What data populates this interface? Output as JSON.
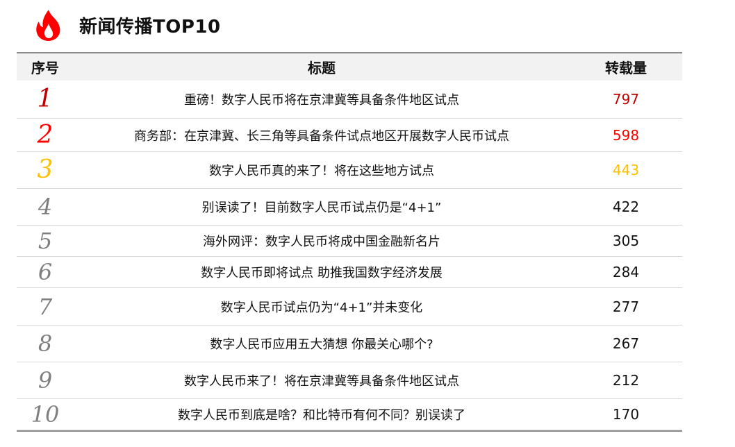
{
  "header": {
    "title": "新闻传播TOP10",
    "icon": "flame-icon",
    "icon_color": "#ff0000"
  },
  "table": {
    "columns": [
      "序号",
      "标题",
      "转载量"
    ],
    "rows": [
      {
        "rank": "1",
        "title": "重磅！数字人民币将在京津冀等具备条件地区试点",
        "count": "797"
      },
      {
        "rank": "2",
        "title": "商务部：在京津冀、长三角等具备条件试点地区开展数字人民币试点",
        "count": "598"
      },
      {
        "rank": "3",
        "title": "数字人民币真的来了！将在这些地方试点",
        "count": "443"
      },
      {
        "rank": "4",
        "title": "别误读了！目前数字人民币试点仍是“4+1”",
        "count": "422"
      },
      {
        "rank": "5",
        "title": "海外网评：数字人民币将成中国金融新名片",
        "count": "305"
      },
      {
        "rank": "6",
        "title": "数字人民币即将试点 助推我国数字经济发展",
        "count": "284"
      },
      {
        "rank": "7",
        "title": "数字人民币试点仍为“4+1”并未变化",
        "count": "277"
      },
      {
        "rank": "8",
        "title": "数字人民币应用五大猜想 你最关心哪个?",
        "count": "267"
      },
      {
        "rank": "9",
        "title": "数字人民币来了！将在京津冀等具备条件地区试点",
        "count": "212"
      },
      {
        "rank": "10",
        "title": "数字人民币到底是啥？和比特币有何不同？别误读了",
        "count": "170"
      }
    ]
  },
  "colors": {
    "rank1": "#c00000",
    "rank2": "#ff0000",
    "rank3": "#ffc000",
    "rank_other": "#7f7f7f",
    "header_bg": "#f2f2f2"
  }
}
